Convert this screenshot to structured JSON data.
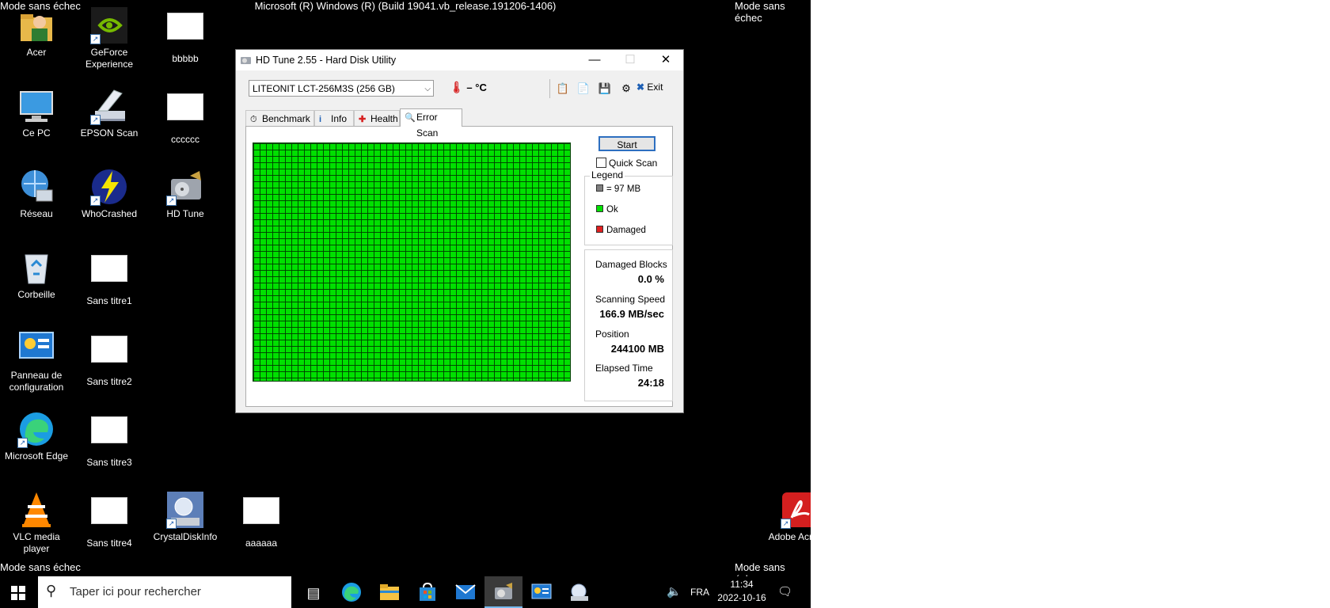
{
  "os": {
    "safe_mode_label": "Mode sans échec",
    "build_label": "Microsoft (R) Windows (R) (Build 19041.vb_release.191206-1406)"
  },
  "desktop_icons": [
    {
      "label": "Acer"
    },
    {
      "label": "GeForce Experience"
    },
    {
      "label": "bbbbb"
    },
    {
      "label": "Ce PC"
    },
    {
      "label": "EPSON Scan"
    },
    {
      "label": "cccccc"
    },
    {
      "label": "Réseau"
    },
    {
      "label": "WhoCrashed"
    },
    {
      "label": "HD Tune"
    },
    {
      "label": "Corbeille"
    },
    {
      "label": "Sans titre1"
    },
    {
      "label": "Panneau de configuration"
    },
    {
      "label": "Sans titre2"
    },
    {
      "label": "Microsoft Edge"
    },
    {
      "label": "Sans titre3"
    },
    {
      "label": "VLC media player"
    },
    {
      "label": "Sans titre4"
    },
    {
      "label": "CrystalDiskInfo"
    },
    {
      "label": "aaaaaa"
    },
    {
      "label": "Adobe Acrobat"
    }
  ],
  "window": {
    "title": "HD Tune 2.55 - Hard Disk Utility",
    "drive": "LITEONIT LCT-256M3S (256 GB)",
    "temperature": "– °C",
    "exit_label": "Exit",
    "tabs": [
      {
        "label": "Benchmark"
      },
      {
        "label": "Info"
      },
      {
        "label": "Health"
      },
      {
        "label": "Error Scan"
      }
    ],
    "active_tab": "Error Scan",
    "start_label": "Start",
    "quick_scan_label": "Quick Scan",
    "legend": {
      "title": "Legend",
      "block_size": "= 97 MB",
      "ok": "Ok",
      "damaged": "Damaged"
    },
    "stats": {
      "damaged_blocks_label": "Damaged Blocks",
      "damaged_blocks_value": "0.0 %",
      "scanning_speed_label": "Scanning Speed",
      "scanning_speed_value": "166.9 MB/sec",
      "position_label": "Position",
      "position_value": "244100 MB",
      "elapsed_label": "Elapsed Time",
      "elapsed_value": "24:18"
    },
    "colors": {
      "ok": "#00e000",
      "damaged": "#e02020",
      "block": "#808080"
    }
  },
  "taskbar": {
    "search_placeholder": "Taper ici pour rechercher",
    "language": "FRA",
    "time": "11:34",
    "date": "2022-10-16"
  }
}
